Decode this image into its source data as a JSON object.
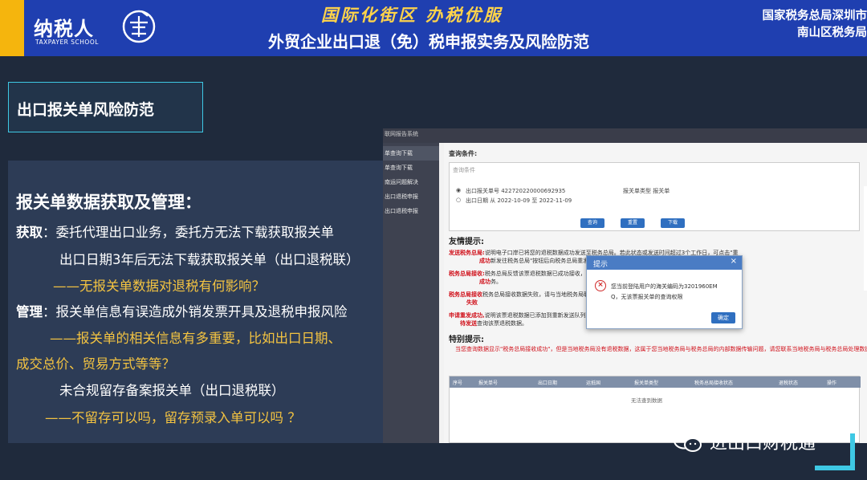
{
  "header": {
    "logo_text": "纳税人",
    "logo_sub": "TAXPAYER SCHOOL",
    "slogan": "国际化街区 办税优服",
    "subtitle": "外贸企业出口退（免）税申报实务及风险防范",
    "bureau_line1": "国家税务总局深圳市",
    "bureau_line2": "南山区税务局",
    "colors": {
      "banner": "#1f3fb0",
      "accent": "#f5b50d",
      "slogan": "#ffd34a"
    }
  },
  "section": {
    "title": "出口报关单风险防范"
  },
  "content": {
    "heading": "报关单数据获取及管理：",
    "acquire_label": "获取",
    "acquire_line1": "：委托代理出口业务，委托方无法下载获取报关单",
    "acquire_line2": "出口日期3年后无法下载获取报关单（出口退税联）",
    "question1": "——无报关单数据对退税有何影响？",
    "manage_label": "管理",
    "manage_line1": "：报关单信息有误造成外销发票开具及退税申报风险",
    "question2_a": "——报关单的相关信息有多重要，比如出口日期、",
    "question2_b": "成交总价、贸易方式等等？",
    "manage_line2": "未合规留存备案报关单（出口退税联）",
    "question3": "——不留存可以吗，留存预录入单可以吗 ？"
  },
  "screenshot": {
    "top_label": "联网报告系统",
    "sidebar": [
      "单查询下载",
      "单查询下载",
      "南运问题解决",
      "出口退税申报",
      "出口退税申报"
    ],
    "query_title": "查询条件:",
    "query_placeholder": "查询条件",
    "row1": "出口报关单号 422720220000692935",
    "row1_right": "报关单类型 报关单",
    "row2": "出口日期 从 2022-10-09    至 2022-11-09",
    "buttons": [
      "查询",
      "重置",
      "下载"
    ],
    "tips_title": "友情提示:",
    "tips": [
      {
        "label": "发送税务总局:",
        "text": "说明电子口岸已将您的退税数据成功发送至税务总局。若此状态或发送时间超过3个工作日，可点击\"重"
      },
      {
        "label": "成功",
        "text": "新发往税务总局\"按钮后向税务总局重发数据。"
      },
      {
        "label": "税务总局接收:",
        "text": "税务总局反馈该票退税数据已成功接收，请与主管税务机关联系，联系当地税务局办理相关业"
      },
      {
        "label": "成功",
        "text": "务。"
      },
      {
        "label": "税务总局接收",
        "text": "税务总局接收数据失败，请与当地税务局联系，可尝试重新发送数据。"
      },
      {
        "label": "失败",
        "text": ""
      },
      {
        "label": "申请重发成功,",
        "text": "说明该票退税数据已添加到重新发送队列，可查看当地税务总局状态，3个工作日后联系当地税务局"
      },
      {
        "label": "待发送",
        "text": "查询该票退税数据。"
      }
    ],
    "special_title": "特别提示:",
    "special_text": "当您查询数据显示\"税务总局接收成功\"，但是当地税务局没有退税数据，这属于您当地税务局与税务总局的内部数据传输问题，请您联系当地税务局与税务总局处理数据解决。",
    "table_headers": [
      "序号",
      "报关单号",
      "出口日期",
      "运抵国",
      "报关单类型",
      "税务总局接收状态",
      "退税状态",
      "操作"
    ],
    "table_empty": "无法查到数据"
  },
  "dialog": {
    "title": "提示",
    "close": "×",
    "message1": "您当前登陆用户的海关编码为3201960EM",
    "message2": "Q，无该票报关单的查询权限",
    "ok": "确定"
  },
  "watermark": {
    "text": "进出口财税通"
  }
}
